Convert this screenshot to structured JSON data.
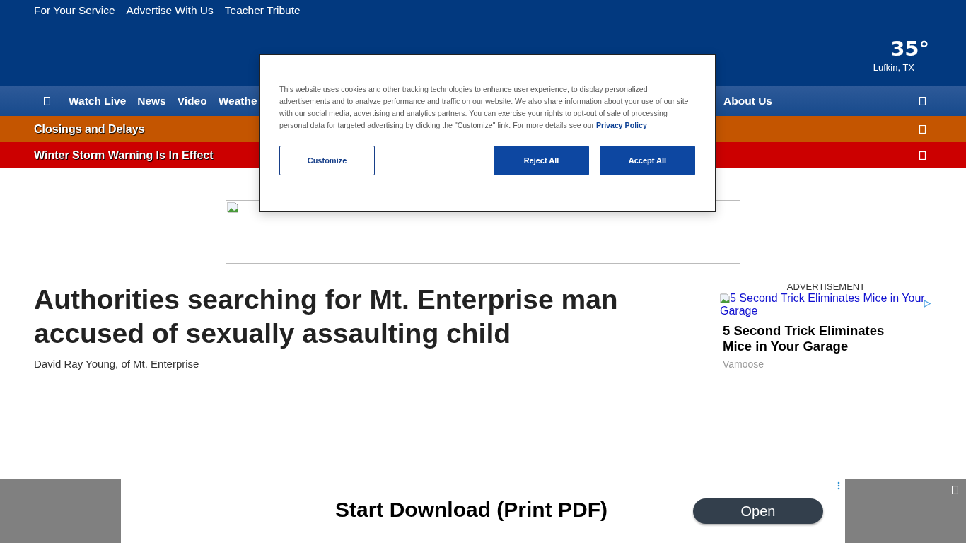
{
  "top_links": [
    "For Your Service",
    "Advertise With Us",
    "Teacher Tribute"
  ],
  "weather": {
    "temperature": "35°",
    "location": "Lufkin, TX"
  },
  "nav": {
    "items": [
      "Watch Live",
      "News",
      "Video",
      "Weathe"
    ],
    "right_item": "About Us"
  },
  "alerts": [
    {
      "text": "Closings and Delays",
      "color": "#c45500"
    },
    {
      "text": "Winter Storm Warning Is In Effect",
      "color": "#cc0000"
    }
  ],
  "cookie_dialog": {
    "text": "This website uses cookies and other tracking technologies to enhance user experience, to display personalized advertisements and to analyze performance and traffic on our website. We also share information about your use of our site with our social media, advertising and analytics partners. You can exercise your rights to opt-out of sale of processing personal data for targeted advertising by clicking the \"Customize\" link. For more details see our",
    "link": "Privacy Policy",
    "buttons": [
      {
        "label": "Customize",
        "kind": "outline"
      },
      {
        "label": "Reject All",
        "kind": "solid"
      },
      {
        "label": "Accept All",
        "kind": "solid"
      }
    ]
  },
  "article": {
    "headline": "Authorities searching for Mt. Enterprise man accused of sexually assaulting child",
    "image_alt": "David Ray Young, of Mt. Enterprise"
  },
  "sidebar_ad": {
    "label": "ADVERTISEMENT",
    "image_alt": "5 Second Trick Eliminates Mice in Your Garage",
    "title": "5 Second Trick Eliminates Mice in Your Garage",
    "source": "Vamoose"
  },
  "bottom_ad": {
    "headline": "Start Download (Print PDF)",
    "button": "Open"
  }
}
